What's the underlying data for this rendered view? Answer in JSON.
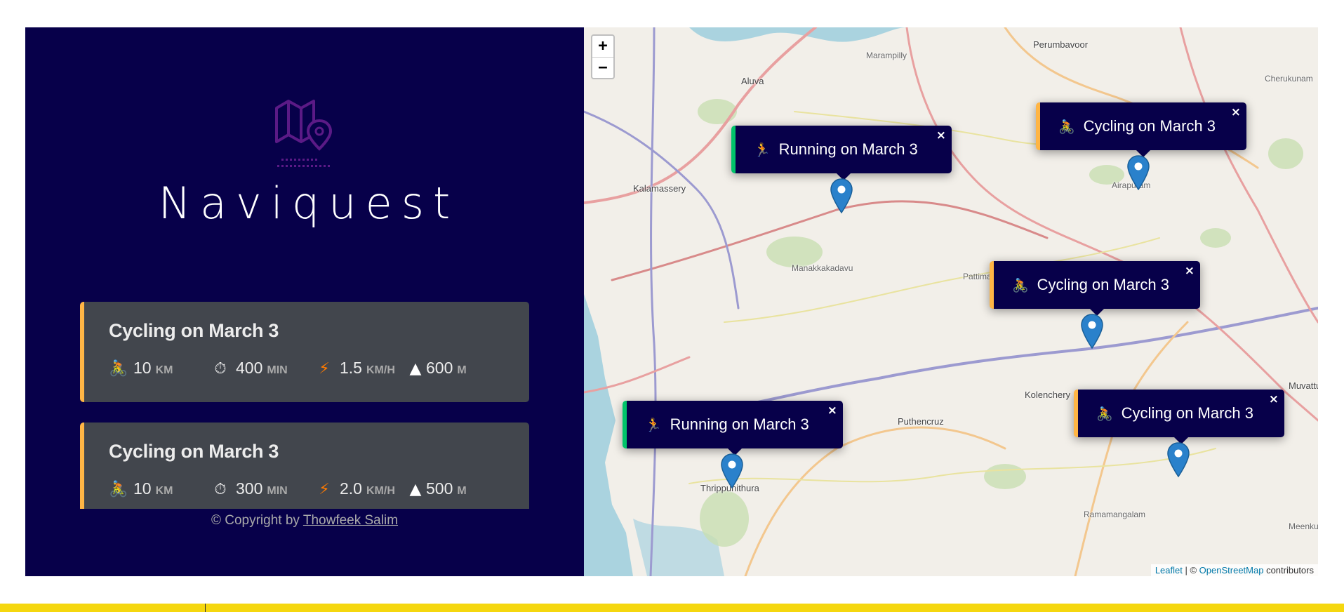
{
  "app": {
    "brand": "Naviquest"
  },
  "workouts": [
    {
      "type": "cycling",
      "title": "Cycling on March 3",
      "icon": "🚴",
      "distance": "10",
      "distance_unit": "KM",
      "duration": "400",
      "duration_unit": "MIN",
      "speed": "1.5",
      "speed_unit": "KM/H",
      "elevation": "600",
      "elevation_unit": "M"
    },
    {
      "type": "cycling",
      "title": "Cycling on March 3",
      "icon": "🚴",
      "distance": "10",
      "distance_unit": "KM",
      "duration": "300",
      "duration_unit": "MIN",
      "speed": "2.0",
      "speed_unit": "KM/H",
      "elevation": "500",
      "elevation_unit": "M"
    }
  ],
  "detail_icons": {
    "duration": "⏱",
    "speed": "⚡",
    "elevation": "▲"
  },
  "footer": {
    "prefix": "© Copyright by",
    "author": "Thowfeek Salim"
  },
  "map": {
    "zoom_in": "+",
    "zoom_out": "−",
    "labels": [
      "Aluva",
      "Marampilly",
      "Perumbavoor",
      "Cherukunam",
      "Kalamassery",
      "Manakkakadavu",
      "Pattimattom",
      "Airapuram",
      "Kolenchery",
      "Puthencruz",
      "Thrippunithura",
      "Ramamangalam",
      "Muvattupuzha",
      "Meenkunnam"
    ],
    "popups": [
      {
        "type": "running",
        "icon": "🏃",
        "text": "Running on March 3",
        "close": "×"
      },
      {
        "type": "cycling",
        "icon": "🚴",
        "text": "Cycling on March 3",
        "close": "×"
      },
      {
        "type": "cycling",
        "icon": "🚴",
        "text": "Cycling on March 3",
        "close": "×"
      },
      {
        "type": "running",
        "icon": "🏃",
        "text": "Running on March 3",
        "close": "×"
      },
      {
        "type": "cycling",
        "icon": "🚴",
        "text": "Cycling on March 3",
        "close": "×"
      }
    ],
    "attribution": {
      "leaflet": "Leaflet",
      "sep": " | © ",
      "osm": "OpenStreetMap",
      "suffix": " contributors"
    }
  },
  "colors": {
    "sidebar_bg": "#07004a",
    "cycling_accent": "#ffb545",
    "running_accent": "#00c46a",
    "card_bg": "#42464d",
    "marker": "#2a81cb",
    "bottom_bar": "#f5d70f"
  }
}
